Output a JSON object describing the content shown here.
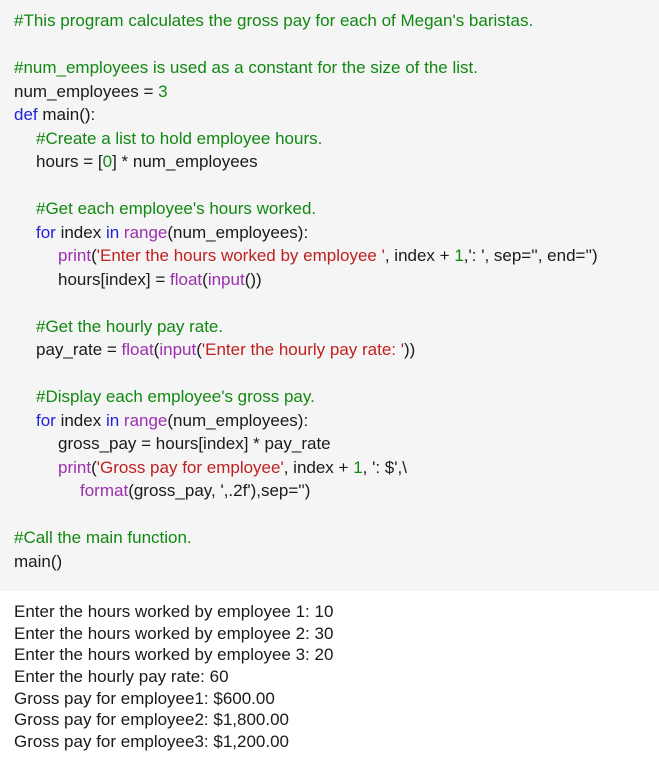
{
  "code": {
    "header_comment": "#This program calculates the gross pay for each of Megan's baristas.",
    "const_comment": "#num_employees is used as a constant for the size of the list.",
    "const_lhs": "num_employees = ",
    "const_val": "3",
    "def_kw": "def",
    "def_rest": " main():",
    "list_comment": "#Create a list to hold employee hours.",
    "hours_lhs": "hours = [",
    "hours_zero": "0",
    "hours_rest": "] * num_employees",
    "get_hours_comment": "#Get each employee's hours worked.",
    "for_kw": "for",
    "for_mid": " index ",
    "in_kw": "in",
    "range_fn": "range",
    "for_rest": "(num_employees):",
    "print_fn": "print",
    "print1_open": "(",
    "print1_str": "'Enter the hours worked by employee '",
    "print1_mid": ", index + ",
    "print1_one": "1",
    "print1_rest": ",': ', sep='', end='')",
    "hours_idx_lhs": "hours[index] = ",
    "float_fn": "float",
    "paren_open": "(",
    "input_fn": "input",
    "input_close": "())",
    "rate_comment": "#Get the hourly pay rate.",
    "rate_lhs": "pay_rate = ",
    "rate_str": "'Enter the hourly pay rate: '",
    "rate_close": "))",
    "display_comment": "#Display each employee's gross pay.",
    "gross_line": "gross_pay = hours[index] * pay_rate",
    "print2_str": "'Gross pay for employee'",
    "print2_mid": ", index + ",
    "print2_one": "1",
    "print2_rest": ", ': $',\\",
    "format_fn": "format",
    "format_rest": "(gross_pay, ',.2f'),sep='')",
    "call_comment": "#Call the main function.",
    "call_line": "main()"
  },
  "output": {
    "lines": [
      "Enter the hours worked by employee 1: 10",
      "Enter the hours worked by employee 2: 30",
      "Enter the hours worked by employee 3: 20",
      "Enter the hourly pay rate: 60",
      "Gross pay for employee1: $600.00",
      "Gross pay for employee2: $1,800.00",
      "Gross pay for employee3: $1,200.00"
    ]
  },
  "colors": {
    "comment": "#118811",
    "keyword": "#2222dd",
    "builtin": "#9b2fae",
    "string": "#c02020",
    "code_background": "#f5f5f5"
  }
}
